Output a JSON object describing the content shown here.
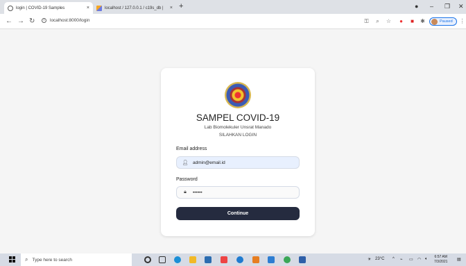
{
  "browser": {
    "tabs": [
      {
        "title": "login | COVID-19 Samples",
        "close": "×",
        "icon": "globe-icon"
      },
      {
        "title": "localhost / 127.0.0.1 / c19s_db | ",
        "close": "×",
        "icon": "phpmyadmin-icon"
      }
    ],
    "new_tab": "+",
    "window_controls": {
      "minimize": "–",
      "maximize": "❐",
      "close": "✕"
    },
    "url": "localhost:8000/login",
    "profile_status": "Paused"
  },
  "login": {
    "title": "SAMPEL COVID-19",
    "subtitle": "Lab Biomolekuler Unsrat Manado",
    "heading": "SILAHKAN LOGIN",
    "email_label": "Email address",
    "email_value": "admin@email.id",
    "password_label": "Password",
    "password_value": "••••••",
    "submit_label": "Continue"
  },
  "taskbar": {
    "search_placeholder": "Type here to search",
    "weather": "23°C",
    "time": "6:57 AM",
    "date": "7/3/2021"
  },
  "colors": {
    "button_bg": "#252b3f",
    "input_autofill_bg": "#e8f0fe",
    "page_bg": "#f5f5f5"
  }
}
